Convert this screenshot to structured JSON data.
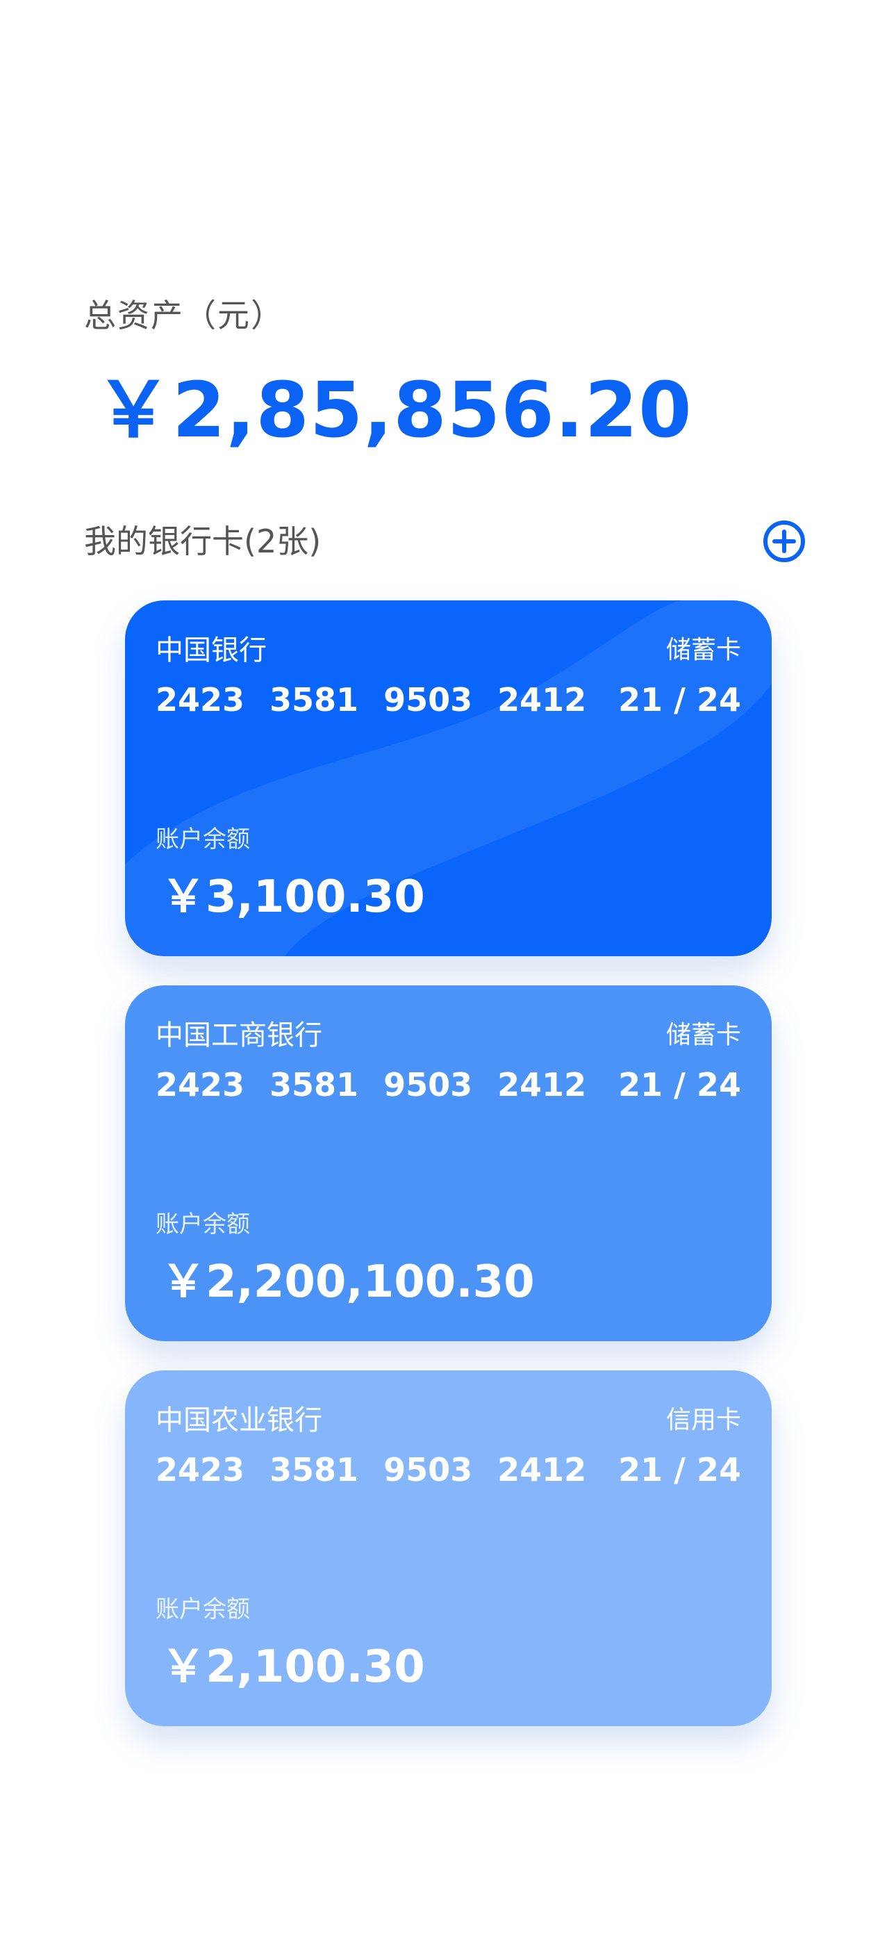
{
  "total": {
    "label": "总资产（元）",
    "amount": "￥2,85,856.20"
  },
  "section": {
    "title": "我的银行卡",
    "count": "(2张)",
    "add_icon": "plus-circle-icon"
  },
  "colors": {
    "accent": "#0a63f5",
    "card1": "#0a66fa",
    "card2": "#4b93f7",
    "card3": "#85b6fb"
  },
  "cards": [
    {
      "bank": "中国银行",
      "type": "储蓄卡",
      "number": [
        "2423",
        "3581",
        "9503",
        "2412"
      ],
      "expiry": "21 / 24",
      "balance_label": "账户余额",
      "balance": "￥3,100.30"
    },
    {
      "bank": "中国工商银行",
      "type": "储蓄卡",
      "number": [
        "2423",
        "3581",
        "9503",
        "2412"
      ],
      "expiry": "21 / 24",
      "balance_label": "账户余额",
      "balance": "￥2,200,100.30"
    },
    {
      "bank": "中国农业银行",
      "type": "信用卡",
      "number": [
        "2423",
        "3581",
        "9503",
        "2412"
      ],
      "expiry": "21 / 24",
      "balance_label": "账户余额",
      "balance": "￥2,100.30"
    }
  ]
}
